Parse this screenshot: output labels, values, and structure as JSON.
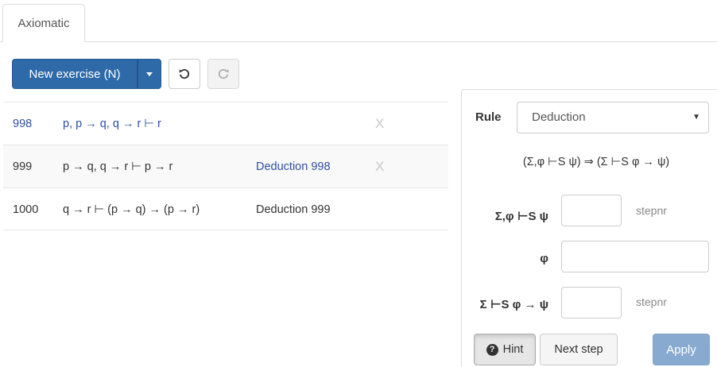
{
  "tabs": [
    {
      "label": "Axiomatic"
    }
  ],
  "toolbar": {
    "new_exercise_label": "New exercise (N)"
  },
  "steps": [
    {
      "number": "998",
      "formula": "p, p → q, q → r ⊢ r",
      "motivation": "",
      "delete": "X"
    },
    {
      "number": "999",
      "formula": "p → q, q → r ⊢ p → r",
      "motivation": "Deduction 998",
      "delete": "X"
    },
    {
      "number": "1000",
      "formula": "q → r ⊢ (p → q) → (p → r)",
      "motivation": "Deduction 999",
      "delete": ""
    }
  ],
  "panel": {
    "rule_label": "Rule",
    "rule_selected": "Deduction",
    "rule_description": "(Σ,φ ⊢S ψ) ⇒ (Σ ⊢S φ → ψ)",
    "fields": [
      {
        "label": "Σ,φ ⊢S ψ",
        "value": "",
        "suffix": "stepnr"
      },
      {
        "label": "φ",
        "value": "",
        "suffix": ""
      },
      {
        "label": "Σ ⊢S φ → ψ",
        "value": "",
        "suffix": "stepnr"
      }
    ],
    "hint_label": "Hint",
    "next_step_label": "Next step",
    "apply_label": "Apply"
  },
  "colors": {
    "primary": "#2f6aa8",
    "link": "#2d4fa0",
    "apply_disabled": "#89aad0"
  },
  "icons": [
    "undo-icon",
    "redo-icon",
    "caret-down-icon",
    "question-circle-icon",
    "delete-x-icon"
  ]
}
